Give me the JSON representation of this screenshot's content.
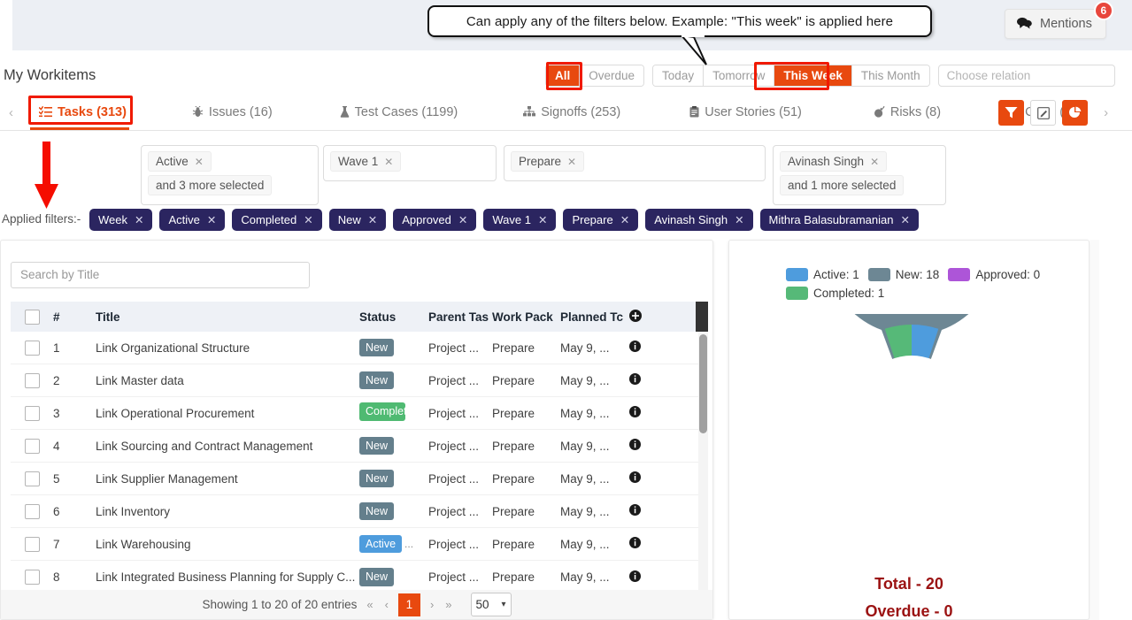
{
  "topbar": {
    "mentions_label": "Mentions",
    "mentions_count": "6",
    "mentions_icon": "chat-bubbles-icon"
  },
  "callout": {
    "text": "Can apply any of the filters below. Example: \"This week\" is applied here"
  },
  "page": {
    "title": "My Workitems"
  },
  "date_filters": {
    "buttons": [
      {
        "label": "All",
        "active": true,
        "highlighted": true
      },
      {
        "label": "Overdue",
        "active": false,
        "highlighted": false
      },
      {
        "label": "Today",
        "active": false,
        "highlighted": false
      },
      {
        "label": "Tomorrow",
        "active": false,
        "highlighted": false
      },
      {
        "label": "This Week",
        "active": true,
        "highlighted": true
      },
      {
        "label": "This Month",
        "active": false,
        "highlighted": false
      }
    ],
    "relation_placeholder": "Choose relation"
  },
  "tabs": {
    "prev_icon": "chevron-left-icon",
    "next_icon": "chevron-right-icon",
    "items": [
      {
        "label": "Tasks (313)",
        "icon": "task-list-icon",
        "active": true
      },
      {
        "label": "Issues (16)",
        "icon": "bug-icon",
        "active": false
      },
      {
        "label": "Test Cases (1199)",
        "icon": "flask-icon",
        "active": false
      },
      {
        "label": "Signoffs (253)",
        "icon": "hierarchy-icon",
        "active": false
      },
      {
        "label": "User Stories (51)",
        "icon": "clipboard-icon",
        "active": false
      },
      {
        "label": "Risks (8)",
        "icon": "bomb-icon",
        "active": false
      },
      {
        "label": "CTAs (83)",
        "icon": "list-icon",
        "active": false
      }
    ],
    "action_icons": [
      {
        "name": "filter-icon",
        "style": "orange"
      },
      {
        "name": "edit-icon",
        "style": "plain"
      },
      {
        "name": "pie-chart-icon",
        "style": "orange"
      }
    ]
  },
  "filter_selects": [
    {
      "chips": [
        "Active"
      ],
      "more": "and 3 more selected"
    },
    {
      "chips": [
        "Wave 1"
      ],
      "more": ""
    },
    {
      "chips": [
        "Prepare"
      ],
      "more": ""
    },
    {
      "chips": [
        "Avinash Singh"
      ],
      "more": "and 1 more selected"
    }
  ],
  "applied_filters": {
    "label": "Applied filters:-",
    "chips": [
      "Week",
      "Active",
      "Completed",
      "New",
      "Approved",
      "Wave 1",
      "Prepare",
      "Avinash Singh",
      "Mithra Balasubramanian"
    ]
  },
  "table": {
    "search_placeholder": "Search by Title",
    "add_column_icon": "plus-circle-icon",
    "columns": [
      "#",
      "Title",
      "Status",
      "Parent Tas",
      "Work Pack",
      "Planned Tc"
    ],
    "rows": [
      {
        "num": "1",
        "title": "Link Organizational Structure",
        "status": "New",
        "status_type": "new",
        "extra": "",
        "parent": "Project ...",
        "workpack": "Prepare",
        "date": "May 9, ...",
        "info_icon": "info-icon"
      },
      {
        "num": "2",
        "title": "Link Master data",
        "status": "New",
        "status_type": "new",
        "extra": "",
        "parent": "Project ...",
        "workpack": "Prepare",
        "date": "May 9, ...",
        "info_icon": "info-icon"
      },
      {
        "num": "3",
        "title": "Link Operational Procurement",
        "status": "Completed",
        "status_type": "completed",
        "extra": "",
        "parent": "Project ...",
        "workpack": "Prepare",
        "date": "May 9, ...",
        "info_icon": "info-icon"
      },
      {
        "num": "4",
        "title": "Link Sourcing and Contract Management",
        "status": "New",
        "status_type": "new",
        "extra": "",
        "parent": "Project ...",
        "workpack": "Prepare",
        "date": "May 9, ...",
        "info_icon": "info-icon"
      },
      {
        "num": "5",
        "title": "Link Supplier Management",
        "status": "New",
        "status_type": "new",
        "extra": "",
        "parent": "Project ...",
        "workpack": "Prepare",
        "date": "May 9, ...",
        "info_icon": "info-icon"
      },
      {
        "num": "6",
        "title": "Link Inventory",
        "status": "New",
        "status_type": "new",
        "extra": "",
        "parent": "Project ...",
        "workpack": "Prepare",
        "date": "May 9, ...",
        "info_icon": "info-icon"
      },
      {
        "num": "7",
        "title": "Link Warehousing",
        "status": "Active",
        "status_type": "active",
        "extra": "...",
        "parent": "Project ...",
        "workpack": "Prepare",
        "date": "May 9, ...",
        "info_icon": "info-icon"
      },
      {
        "num": "8",
        "title": "Link Integrated Business Planning for Supply C...",
        "status": "New",
        "status_type": "new",
        "extra": "",
        "parent": "Project ...",
        "workpack": "Prepare",
        "date": "May 9, ...",
        "info_icon": "info-icon"
      }
    ],
    "pagination": {
      "showing": "Showing 1 to 20 of 20 entries",
      "first_icon": "double-chevron-left-icon",
      "prev_icon": "chevron-left-icon",
      "current_page": "1",
      "next_icon": "chevron-right-icon",
      "last_icon": "double-chevron-right-icon",
      "page_size": "50",
      "page_size_icon": "chevron-down-icon"
    }
  },
  "chart_data": {
    "type": "pie",
    "title": "",
    "variant": "donut",
    "categories": [
      "Active",
      "New",
      "Approved",
      "Completed"
    ],
    "values": [
      1,
      18,
      0,
      1
    ],
    "colors": [
      "#4e9cdd",
      "#6d8794",
      "#ad55d8",
      "#56b978"
    ],
    "legend": [
      {
        "label": "Active: 1",
        "color": "#4e9cdd"
      },
      {
        "label": "New: 18",
        "color": "#6d8794"
      },
      {
        "label": "Approved: 0",
        "color": "#ad55d8"
      },
      {
        "label": "Completed: 1",
        "color": "#56b978"
      }
    ],
    "legend_position": "top",
    "totals": {
      "total": "Total - 20",
      "overdue": "Overdue - 0"
    }
  }
}
